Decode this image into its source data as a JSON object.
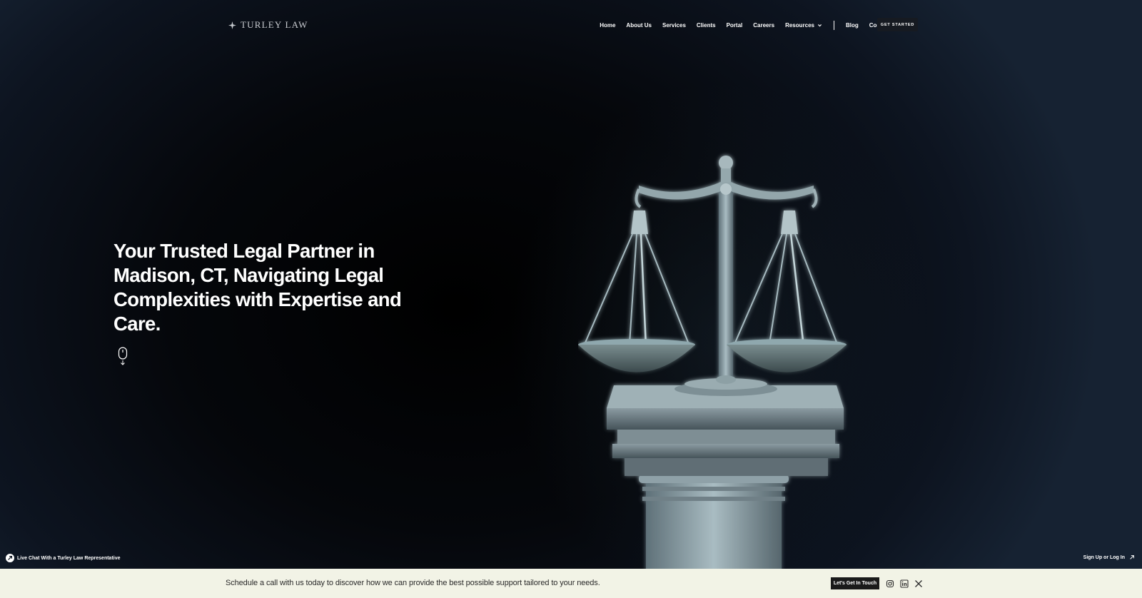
{
  "brand": {
    "name": "TURLEY LAW"
  },
  "nav": {
    "items": [
      "Home",
      "About Us",
      "Services",
      "Clients",
      "Portal",
      "Careers",
      "Resources"
    ],
    "secondary": [
      "Blog",
      "Contact Us"
    ],
    "cta": "GET STARTED"
  },
  "hero": {
    "headline": "Your Trusted Legal Partner in Madison, CT, Navigating Legal Complexities with Expertise and Care."
  },
  "overlay": {
    "live_chat": "Live Chat With a Turley Law Representative",
    "sign_up": "Sign Up or Log In"
  },
  "bar": {
    "text": "Schedule a call with us today to discover how we can provide the best possible support tailored to your needs.",
    "cta": "Let's Get In Touch"
  },
  "colors": {
    "hero_bg": "#05070b",
    "scale_metal": "#8fa5ad",
    "bar_bg": "#f2f3e6",
    "button_dark": "#1a1a1a"
  },
  "icons": [
    "sparkle-icon",
    "chevron-down-icon",
    "mouse-scroll-icon",
    "chat-arrow-icon",
    "external-arrow-icon",
    "instagram-icon",
    "linkedin-icon",
    "x-icon"
  ]
}
